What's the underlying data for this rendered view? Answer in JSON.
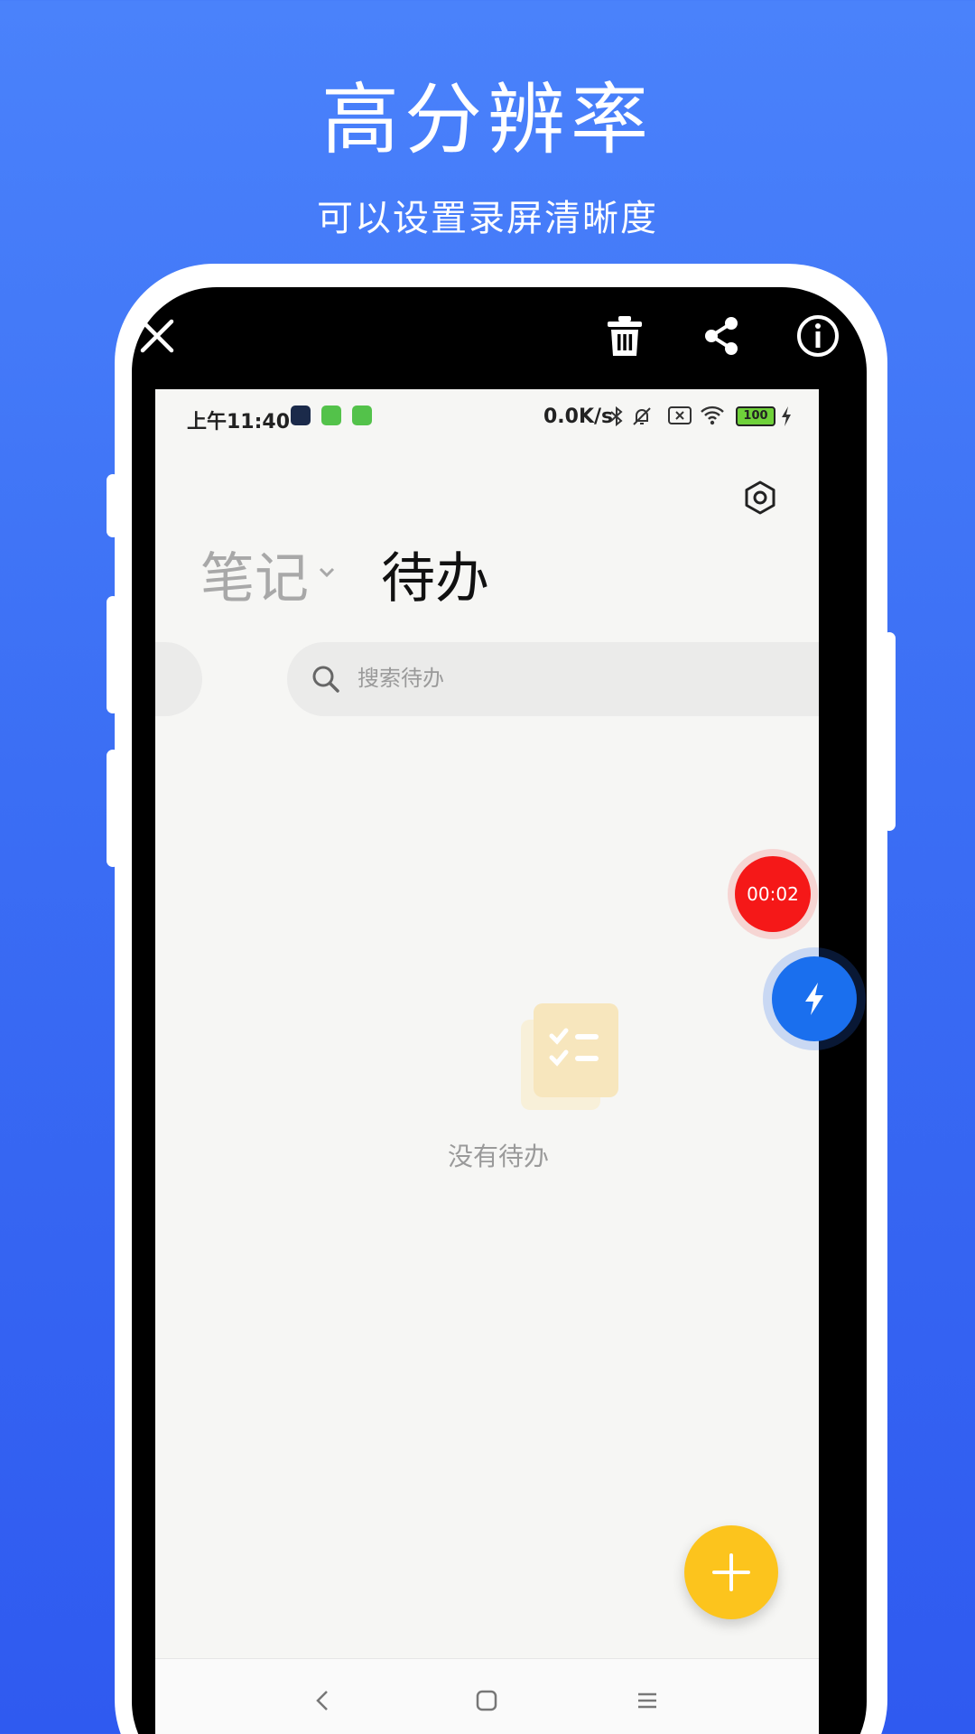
{
  "promo": {
    "title": "高分辨率",
    "subtitle": "可以设置录屏清晰度"
  },
  "viewer_toolbar": {
    "icons": [
      "close-icon",
      "trash-icon",
      "share-icon",
      "info-icon"
    ]
  },
  "status_bar": {
    "time": "上午11:40",
    "net_speed": "0.0K/s",
    "battery": "100"
  },
  "app": {
    "tab_notes": "笔记",
    "tab_todo": "待办",
    "search_placeholder": "搜索待办",
    "empty_text": "没有待办"
  },
  "overlay": {
    "record_timer": "00:02"
  },
  "colors": {
    "background": "#3b6ef4",
    "fab": "#fcc41d",
    "record": "#f51818",
    "quick_ball": "#1a6fee"
  }
}
